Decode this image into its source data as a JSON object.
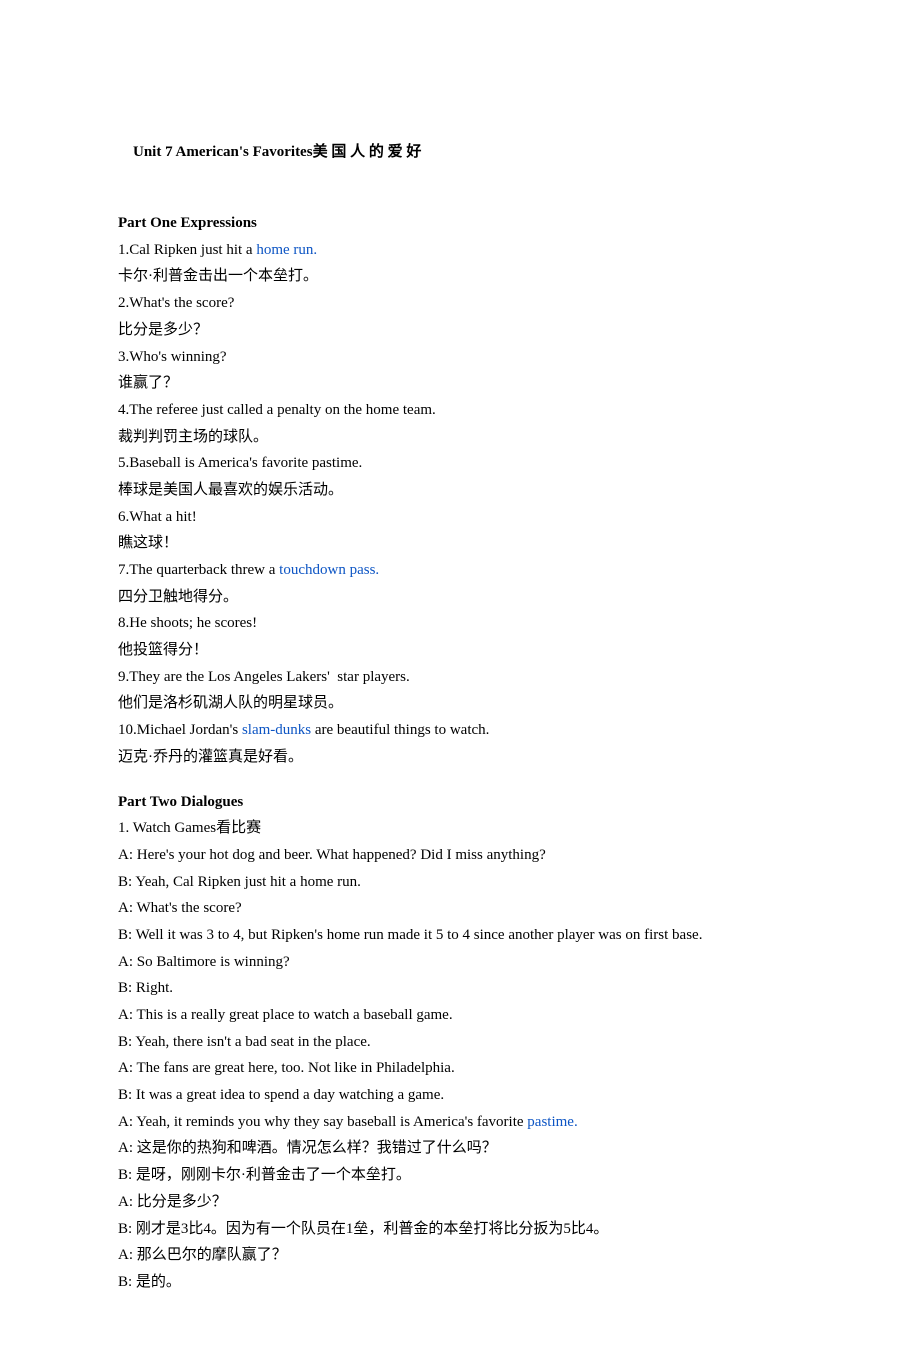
{
  "title_prefix": "Unit 7 American's Favorites",
  "title_cn": "美 国 人 的 爱 好",
  "part1_heading": "Part One Expressions",
  "expr": [
    {
      "pre": "1.Cal Ripken just hit a ",
      "link": "home run.",
      "post": ""
    },
    {
      "pre": "卡尔·利普金击出一个本垒打。"
    },
    {
      "pre": "2.What's the score?"
    },
    {
      "pre": "比分是多少？"
    },
    {
      "pre": "3.Who's winning?"
    },
    {
      "pre": "谁赢了？"
    },
    {
      "pre": "4.The referee just called a penalty on the home team."
    },
    {
      "pre": "裁判判罚主场的球队。"
    },
    {
      "pre": "5.Baseball is America's favorite pastime."
    },
    {
      "pre": "棒球是美国人最喜欢的娱乐活动。"
    },
    {
      "pre": "6.What a hit!"
    },
    {
      "pre": "瞧这球！"
    },
    {
      "pre": "7.The quarterback threw a ",
      "link": "touchdown pass.",
      "post": ""
    },
    {
      "pre": "四分卫触地得分。"
    },
    {
      "pre": "8.He shoots; he scores!"
    },
    {
      "pre": "他投篮得分！"
    },
    {
      "pre": "9.They are the Los Angeles Lakers'  star players."
    },
    {
      "pre": "他们是洛杉矶湖人队的明星球员。"
    },
    {
      "pre": "10.Michael Jordan's ",
      "link": "slam-dunks",
      "post": " are beautiful things to watch."
    },
    {
      "pre": "迈克·乔丹的灌篮真是好看。"
    }
  ],
  "part2_heading": "Part Two Dialogues",
  "dialog": [
    {
      "t": "1. Watch Games看比赛"
    },
    {
      "t": "A: Here's your hot dog and beer. What happened? Did I miss anything?"
    },
    {
      "t": "B: Yeah, Cal Ripken just hit a home run."
    },
    {
      "t": "A: What's the score?"
    },
    {
      "t": "B: Well it was 3 to 4, but Ripken's home run made it 5 to 4 since another player was on first base."
    },
    {
      "t": "A: So Baltimore is winning?"
    },
    {
      "t": "B: Right."
    },
    {
      "t": "A: This is a really great place to watch a baseball game."
    },
    {
      "t": "B: Yeah, there isn't a bad seat in the place."
    },
    {
      "t": "A: The fans are great here, too. Not like in Philadelphia."
    },
    {
      "t": "B: It was a great idea to spend a day watching a game."
    },
    {
      "pre": "A: Yeah, it reminds you why they say baseball is America's favorite ",
      "link": "pastime.",
      "post": ""
    },
    {
      "t": "A: 这是你的热狗和啤酒。情况怎么样？我错过了什么吗？"
    },
    {
      "t": "B: 是呀，刚刚卡尔·利普金击了一个本垒打。"
    },
    {
      "t": "A: 比分是多少？"
    },
    {
      "t": "B: 刚才是3比4。因为有一个队员在1垒，利普金的本垒打将比分扳为5比4。"
    },
    {
      "t": "A: 那么巴尔的摩队赢了？"
    },
    {
      "t": "B: 是的。"
    }
  ]
}
